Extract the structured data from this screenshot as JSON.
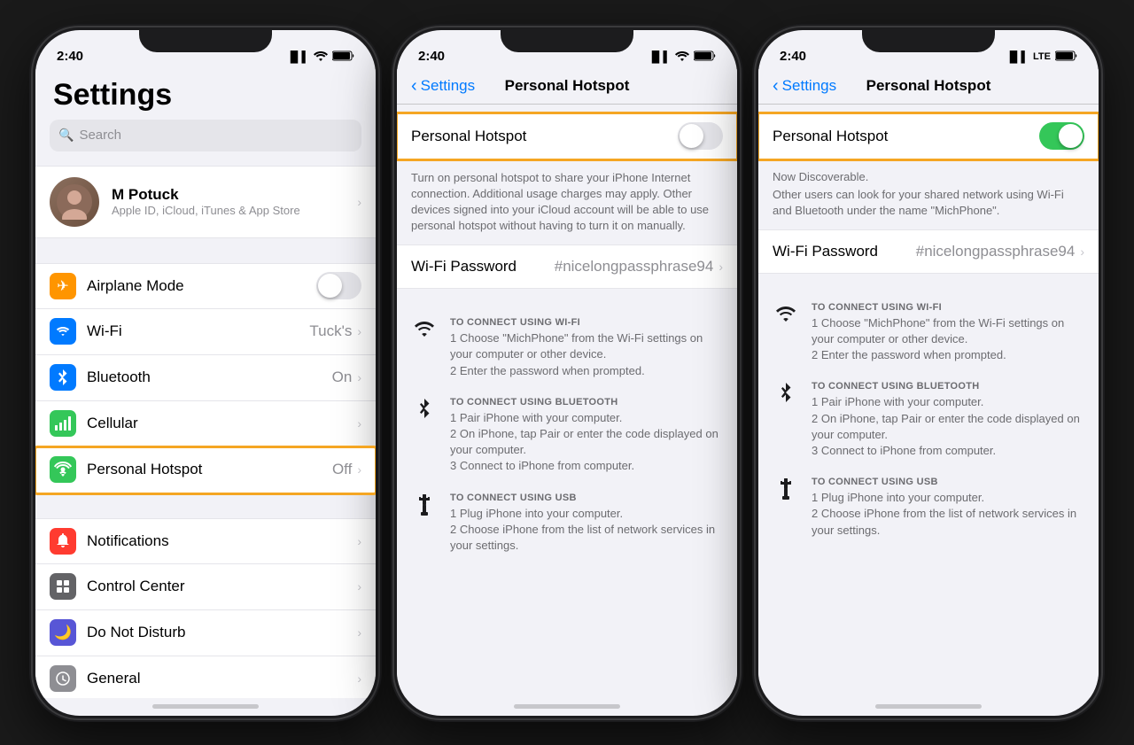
{
  "colors": {
    "orange_outline": "#f5a623",
    "green_toggle": "#34c759",
    "blue_link": "#007aff",
    "gray_toggle": "#e5e5ea",
    "cell_bg": "#ffffff",
    "screen_bg": "#f2f2f7"
  },
  "phone1": {
    "status_time": "2:40",
    "title": "Settings",
    "search_placeholder": "Search",
    "account": {
      "name": "M Potuck",
      "subtitle": "Apple ID, iCloud, iTunes & App Store"
    },
    "settings_items": [
      {
        "icon": "✈",
        "icon_bg": "#ff9500",
        "label": "Airplane Mode",
        "value": "",
        "type": "toggle"
      },
      {
        "icon": "📶",
        "icon_bg": "#007aff",
        "label": "Wi-Fi",
        "value": "Tuck's",
        "type": "nav"
      },
      {
        "icon": "✦",
        "icon_bg": "#007aff",
        "label": "Bluetooth",
        "value": "On",
        "type": "nav"
      },
      {
        "icon": "📡",
        "icon_bg": "#34c759",
        "label": "Cellular",
        "value": "",
        "type": "nav"
      },
      {
        "icon": "⬡",
        "icon_bg": "#34c759",
        "label": "Personal Hotspot",
        "value": "Off",
        "type": "nav",
        "highlighted": true
      }
    ],
    "settings_items2": [
      {
        "icon": "🔔",
        "icon_bg": "#ff3b30",
        "label": "Notifications",
        "value": "",
        "type": "nav"
      },
      {
        "icon": "⚏",
        "icon_bg": "#636366",
        "label": "Control Center",
        "value": "",
        "type": "nav"
      },
      {
        "icon": "🌙",
        "icon_bg": "#5856d6",
        "label": "Do Not Disturb",
        "value": "",
        "type": "nav"
      },
      {
        "icon": "⚙",
        "icon_bg": "#8e8e93",
        "label": "General",
        "value": "",
        "type": "nav"
      }
    ]
  },
  "phone2": {
    "status_time": "2:40",
    "nav_back": "Settings",
    "nav_title": "Personal Hotspot",
    "toggle_label": "Personal Hotspot",
    "toggle_state": "off",
    "description": "Turn on personal hotspot to share your iPhone Internet connection. Additional usage charges may apply. Other devices signed into your iCloud account will be able to use personal hotspot without having to turn it on manually.",
    "wifi_password_label": "Wi-Fi Password",
    "wifi_password_value": "#nicelongpassphrase94",
    "connect_sections": [
      {
        "icon": "wifi",
        "title": "TO CONNECT USING WI-FI",
        "steps": [
          "1 Choose \"MichPhone\" from the Wi-Fi settings on your computer or other device.",
          "2 Enter the password when prompted."
        ]
      },
      {
        "icon": "bluetooth",
        "title": "TO CONNECT USING BLUETOOTH",
        "steps": [
          "1 Pair iPhone with your computer.",
          "2 On iPhone, tap Pair or enter the code displayed on your computer.",
          "3 Connect to iPhone from computer."
        ]
      },
      {
        "icon": "usb",
        "title": "TO CONNECT USING USB",
        "steps": [
          "1 Plug iPhone into your computer.",
          "2 Choose iPhone from the list of network services in your settings."
        ]
      }
    ]
  },
  "phone3": {
    "status_time": "2:40",
    "status_extra": "LTE",
    "nav_back": "Settings",
    "nav_title": "Personal Hotspot",
    "toggle_label": "Personal Hotspot",
    "toggle_state": "on",
    "discoverable_title": "Now Discoverable.",
    "discoverable_sub": "Other users can look for your shared network using Wi-Fi and Bluetooth under the name \"MichPhone\".",
    "wifi_password_label": "Wi-Fi Password",
    "wifi_password_value": "#nicelongpassphrase94",
    "connect_sections": [
      {
        "icon": "wifi",
        "title": "TO CONNECT USING WI-FI",
        "steps": [
          "1 Choose \"MichPhone\" from the Wi-Fi settings on your computer or other device.",
          "2 Enter the password when prompted."
        ]
      },
      {
        "icon": "bluetooth",
        "title": "TO CONNECT USING BLUETOOTH",
        "steps": [
          "1 Pair iPhone with your computer.",
          "2 On iPhone, tap Pair or enter the code displayed on your computer.",
          "3 Connect to iPhone from computer."
        ]
      },
      {
        "icon": "usb",
        "title": "TO CONNECT USING USB",
        "steps": [
          "1 Plug iPhone into your computer.",
          "2 Choose iPhone from the list of network services in your settings."
        ]
      }
    ]
  }
}
